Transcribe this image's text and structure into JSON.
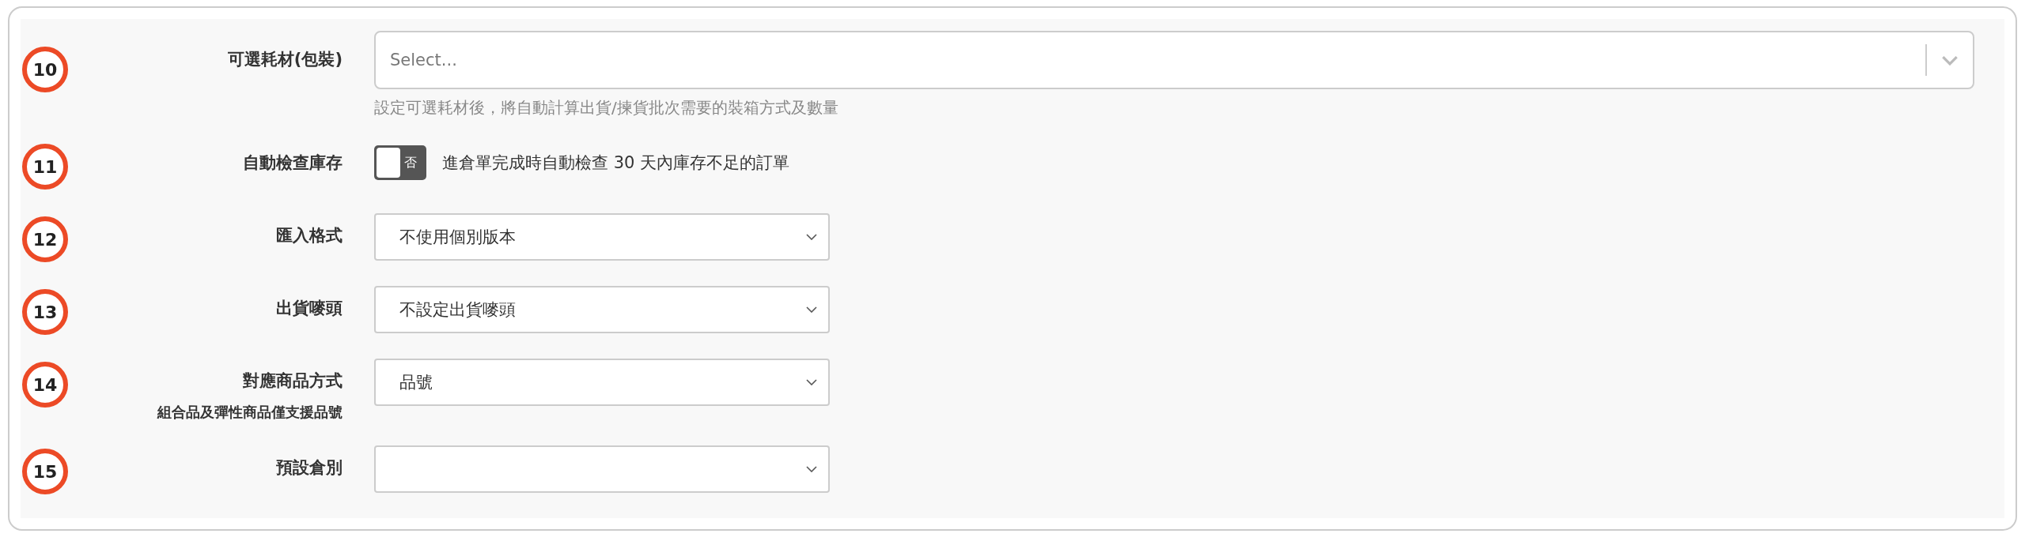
{
  "fields": [
    {
      "number": "10",
      "label": "可選耗材(包裝)",
      "kind": "multiselect",
      "placeholder": "Select...",
      "help": "設定可選耗材後，將自動計算出貨/揀貨批次需要的裝箱方式及數量"
    },
    {
      "number": "11",
      "label": "自動檢查庫存",
      "kind": "toggle",
      "on": false,
      "toggle_text": "否",
      "description": "進倉單完成時自動檢查 30 天內庫存不足的訂單"
    },
    {
      "number": "12",
      "label": "匯入格式",
      "kind": "select",
      "value": "不使用個別版本"
    },
    {
      "number": "13",
      "label": "出貨嘜頭",
      "kind": "select",
      "value": "不設定出貨嘜頭"
    },
    {
      "number": "14",
      "label": "對應商品方式",
      "sublabel": "組合品及彈性商品僅支援品號",
      "kind": "select",
      "value": "品號"
    },
    {
      "number": "15",
      "label": "預設倉別",
      "kind": "select"
    }
  ]
}
